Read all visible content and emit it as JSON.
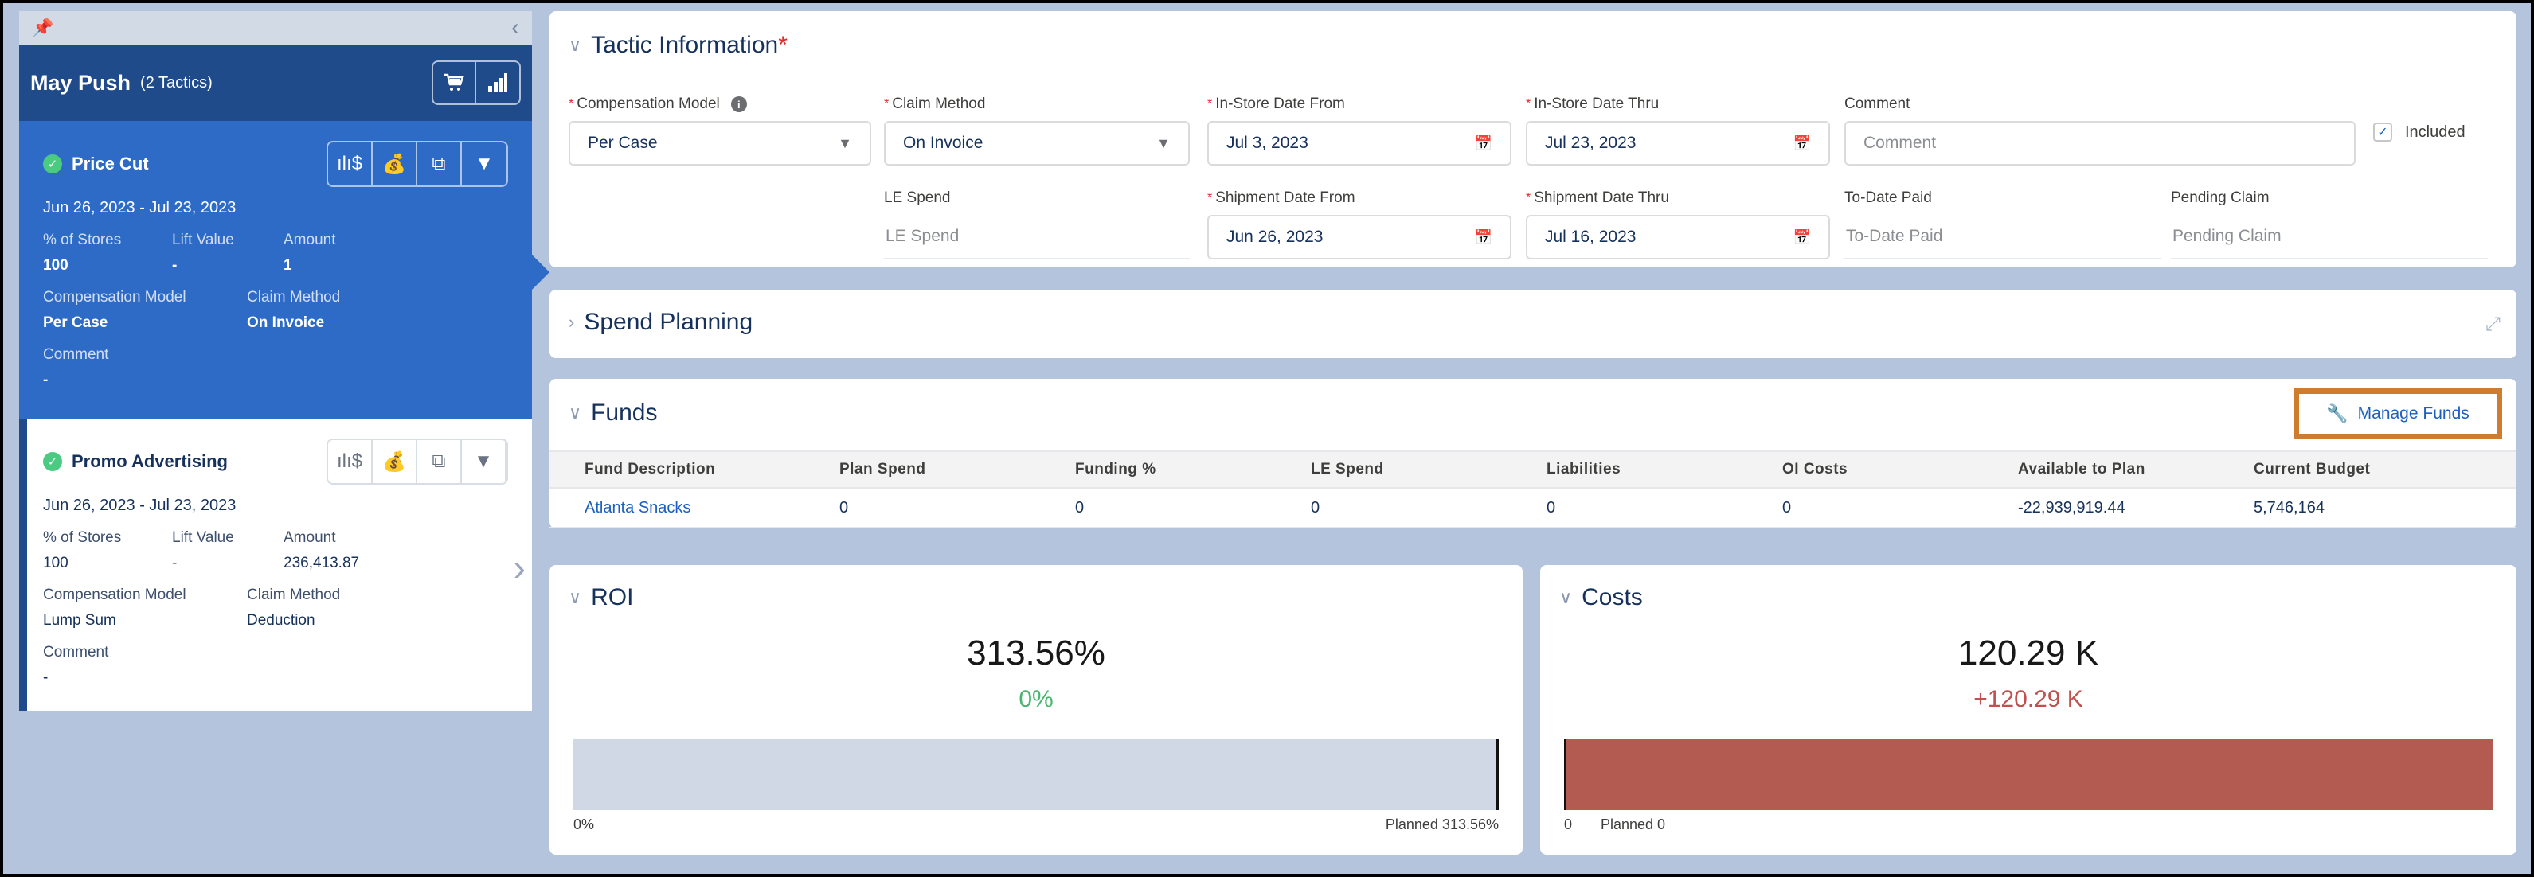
{
  "sidebar": {
    "pin_icon": "pin-icon",
    "collapse_icon": "chevron-left-icon",
    "promotion": {
      "name": "May Push",
      "tactic_count": "(2 Tactics)",
      "actions": [
        {
          "icon": "cart-icon",
          "glyph": "🛒"
        },
        {
          "icon": "bar-chart-icon",
          "glyph": "▂▄▆█"
        }
      ]
    },
    "tactics": [
      {
        "name": "Price Cut",
        "status": "valid",
        "selected": true,
        "dates": "Jun 26, 2023 - Jul 23, 2023",
        "fields_row1": [
          {
            "label": "% of Stores",
            "value": "100"
          },
          {
            "label": "Lift Value",
            "value": "-"
          },
          {
            "label": "Amount",
            "value": "1"
          }
        ],
        "fields_row2": [
          {
            "label": "Compensation Model",
            "value": "Per Case"
          },
          {
            "label": "Claim Method",
            "value": "On Invoice"
          }
        ],
        "comment": {
          "label": "Comment",
          "value": "-"
        },
        "actions": [
          "chart-dollar-icon",
          "money-bag-icon",
          "copy-add-icon",
          "dropdown-icon"
        ]
      },
      {
        "name": "Promo Advertising",
        "status": "valid",
        "selected": false,
        "dates": "Jun 26, 2023 - Jul 23, 2023",
        "fields_row1": [
          {
            "label": "% of Stores",
            "value": "100"
          },
          {
            "label": "Lift Value",
            "value": "-"
          },
          {
            "label": "Amount",
            "value": "236,413.87"
          }
        ],
        "fields_row2": [
          {
            "label": "Compensation Model",
            "value": "Lump Sum"
          },
          {
            "label": "Claim Method",
            "value": "Deduction"
          }
        ],
        "comment": {
          "label": "Comment",
          "value": "-"
        },
        "actions": [
          "chart-dollar-icon",
          "money-bag-icon",
          "copy-add-icon",
          "dropdown-icon"
        ]
      }
    ]
  },
  "tactic_info": {
    "title": "Tactic Information",
    "required_mark": "*",
    "fields": {
      "compensation_model": {
        "label": "Compensation Model",
        "required": true,
        "value": "Per Case",
        "type": "select"
      },
      "claim_method": {
        "label": "Claim Method",
        "required": true,
        "value": "On Invoice",
        "type": "select"
      },
      "instore_from": {
        "label": "In-Store Date From",
        "required": true,
        "value": "Jul 3, 2023",
        "type": "date"
      },
      "instore_thru": {
        "label": "In-Store Date Thru",
        "required": true,
        "value": "Jul 23, 2023",
        "type": "date"
      },
      "comment": {
        "label": "Comment",
        "placeholder": "Comment",
        "value": ""
      },
      "le_spend": {
        "label": "LE Spend",
        "placeholder": "LE Spend"
      },
      "shipment_from": {
        "label": "Shipment Date From",
        "required": true,
        "value": "Jun 26, 2023",
        "type": "date"
      },
      "shipment_thru": {
        "label": "Shipment Date Thru",
        "required": true,
        "value": "Jul 16, 2023",
        "type": "date"
      },
      "to_date_paid": {
        "label": "To-Date Paid",
        "placeholder": "To-Date Paid"
      },
      "pending_claim": {
        "label": "Pending Claim",
        "placeholder": "Pending Claim"
      }
    },
    "included": {
      "label": "Included",
      "checked": true
    }
  },
  "spend_planning": {
    "title": "Spend Planning",
    "expand_icon": "expand-icon"
  },
  "funds": {
    "title": "Funds",
    "manage_button": "Manage Funds",
    "columns": [
      "Fund Description",
      "Plan Spend",
      "Funding %",
      "LE Spend",
      "Liabilities",
      "OI Costs",
      "Available to Plan",
      "Current Budget"
    ],
    "rows": [
      [
        "Atlanta Snacks",
        "0",
        "0",
        "0",
        "0",
        "0",
        "-22,939,919.44",
        "5,746,164"
      ]
    ]
  },
  "roi": {
    "title": "ROI",
    "value": "313.56%",
    "delta": "0%",
    "delta_color": "#4bb56f",
    "fill_fraction": 1.0,
    "fill_color": "#d0d8e6",
    "planned_marker_fraction": 1.0,
    "axis_min_label": "0%",
    "planned_label": "Planned 313.56%"
  },
  "costs": {
    "title": "Costs",
    "value": "120.29 K",
    "delta": "+120.29 K",
    "delta_color": "#c0504d",
    "fill_fraction": 1.0,
    "fill_color": "#b35b50",
    "planned_marker_fraction": 0.0,
    "axis_min_label": "0",
    "planned_label": "Planned 0"
  },
  "colors": {
    "background": "#b3c4dc",
    "sidebar_header": "#1f4b8a",
    "selected_card": "#2e6bc6",
    "link": "#1b5fc1",
    "highlight_box": "#cf7c2e",
    "required": "#e02b2b"
  }
}
